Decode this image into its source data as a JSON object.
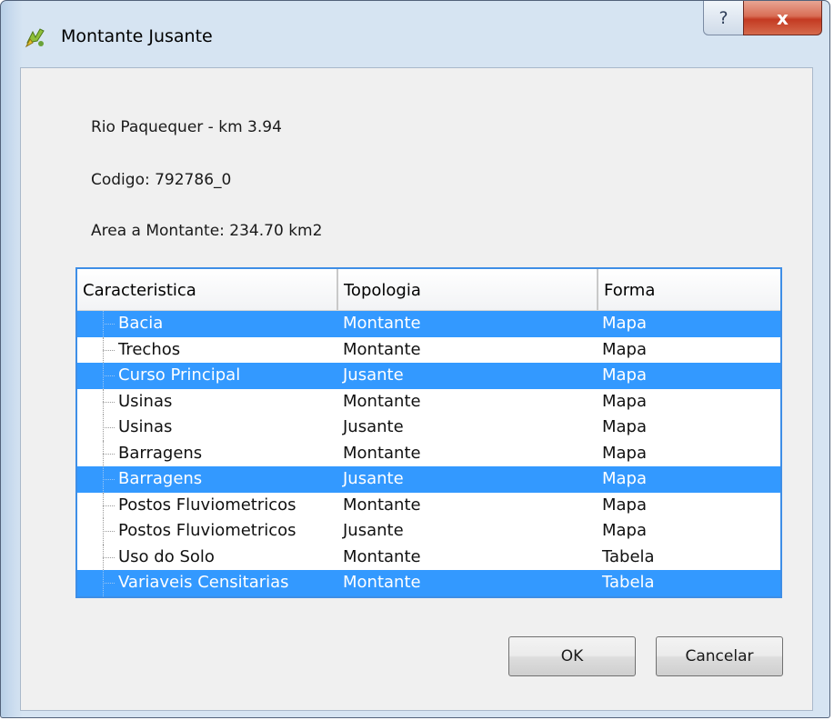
{
  "window": {
    "title": "Montante Jusante",
    "help_label": "?",
    "close_label": "x"
  },
  "info": {
    "river": "Rio Paquequer - km 3.94",
    "code": "Codigo: 792786_0",
    "area": "Area a Montante: 234.70 km2"
  },
  "tree": {
    "columns": [
      "Caracteristica",
      "Topologia",
      "Forma"
    ],
    "rows": [
      {
        "caracteristica": "Bacia",
        "topologia": "Montante",
        "forma": "Mapa",
        "selected": true
      },
      {
        "caracteristica": "Trechos",
        "topologia": "Montante",
        "forma": "Mapa",
        "selected": false
      },
      {
        "caracteristica": "Curso Principal",
        "topologia": "Jusante",
        "forma": "Mapa",
        "selected": true
      },
      {
        "caracteristica": "Usinas",
        "topologia": "Montante",
        "forma": "Mapa",
        "selected": false
      },
      {
        "caracteristica": "Usinas",
        "topologia": "Jusante",
        "forma": "Mapa",
        "selected": false
      },
      {
        "caracteristica": "Barragens",
        "topologia": "Montante",
        "forma": "Mapa",
        "selected": false
      },
      {
        "caracteristica": "Barragens",
        "topologia": "Jusante",
        "forma": "Mapa",
        "selected": true
      },
      {
        "caracteristica": "Postos Fluviometricos",
        "topologia": "Montante",
        "forma": "Mapa",
        "selected": false
      },
      {
        "caracteristica": "Postos Fluviometricos",
        "topologia": "Jusante",
        "forma": "Mapa",
        "selected": false
      },
      {
        "caracteristica": "Uso do Solo",
        "topologia": "Montante",
        "forma": "Tabela",
        "selected": false
      },
      {
        "caracteristica": "Variaveis Censitarias",
        "topologia": "Montante",
        "forma": "Tabela",
        "selected": true
      }
    ]
  },
  "buttons": {
    "ok": "OK",
    "cancel": "Cancelar"
  },
  "colors": {
    "selection": "#3399ff",
    "close_button": "#c43a22",
    "tree_border": "#3e8ee6"
  }
}
